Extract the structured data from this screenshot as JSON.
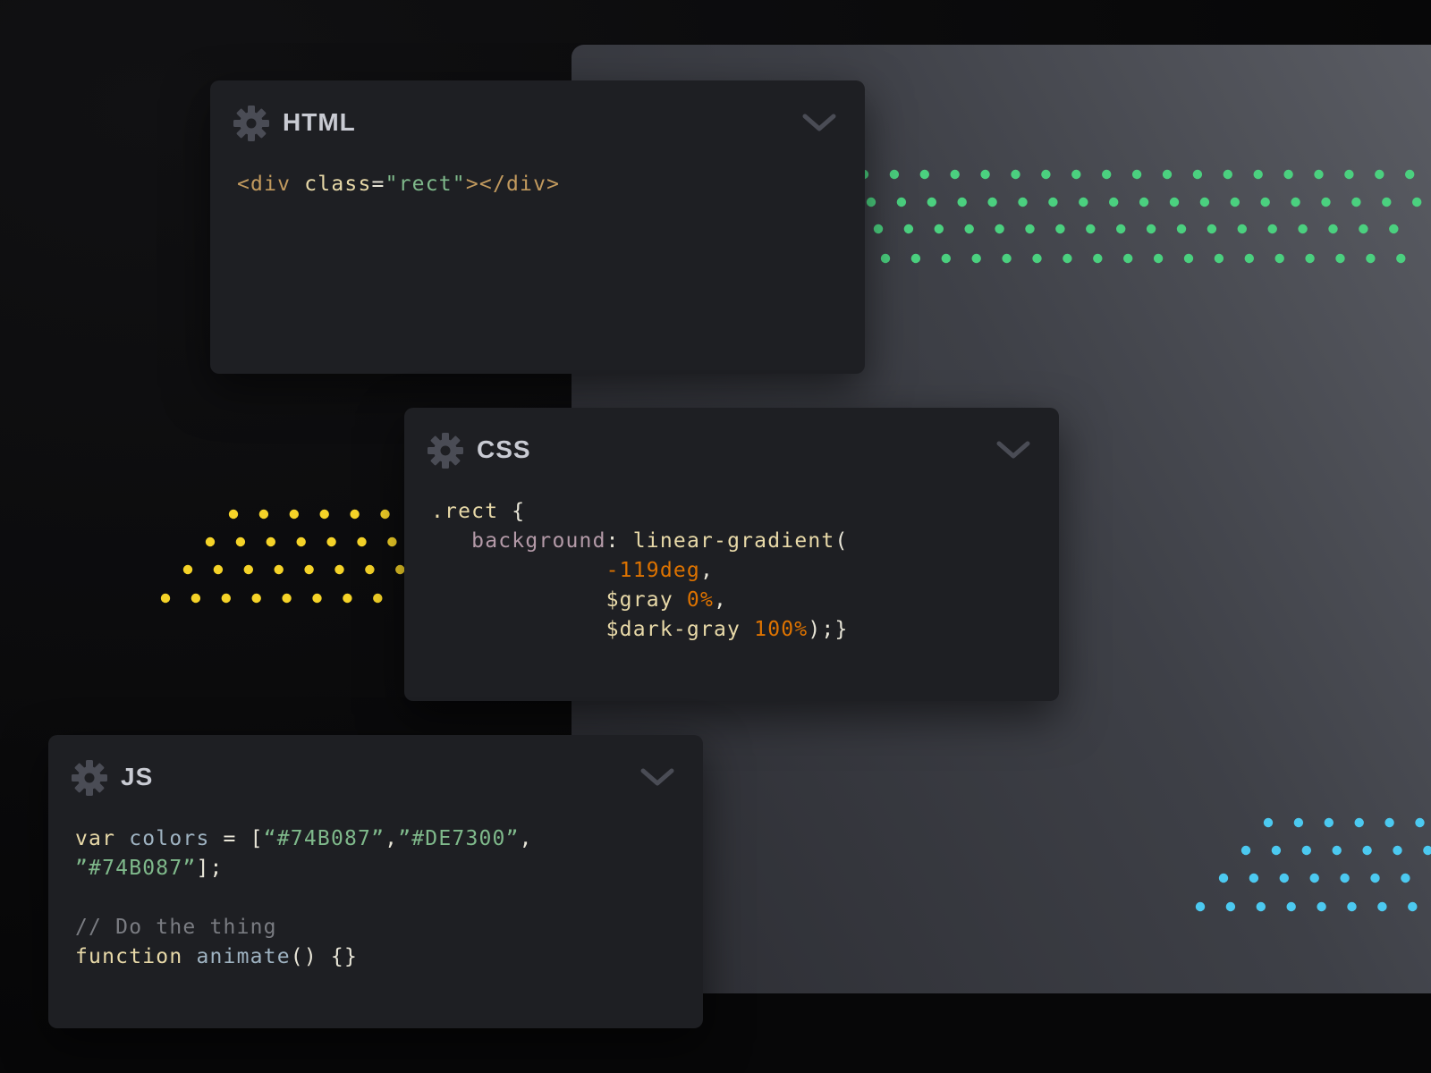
{
  "colors": {
    "background": "#070708",
    "preview_light": "#5a5c63",
    "preview_dark": "#2c2d33",
    "panel": "#1e1f23",
    "title": "#c9cbd3",
    "icon": "#4a4c55",
    "dots_green": "#4bd07f",
    "dots_yellow": "#f5d328",
    "dots_blue": "#4cc9f0"
  },
  "icons": {
    "settings": "gear-icon",
    "collapse": "chevron-down-icon"
  },
  "panels": {
    "html": {
      "title": "HTML",
      "code": {
        "l1_open": "<div ",
        "l1_attr": "class",
        "l1_eq": "=",
        "l1_val": "\"rect\"",
        "l1_close": "></div>"
      }
    },
    "css": {
      "title": "CSS",
      "code": {
        "l1_sel": ".rect ",
        "l1_brace": "{",
        "l2_indent": "   ",
        "l2_prop": "background",
        "l2_colon": ": ",
        "l2_func": "linear-gradient",
        "l2_paren": "(",
        "indent": "             ",
        "l3_num": "-119deg",
        "l3_comma": ",",
        "l4_var": "$gray ",
        "l4_num": "0%",
        "l4_comma": ",",
        "l5_var": "$dark-gray ",
        "l5_num": "100%",
        "l5_end": ");}"
      }
    },
    "js": {
      "title": "JS",
      "code": {
        "l1_kw": "var ",
        "l1_ident": "colors",
        "l1_eq": " = [",
        "l1_s1": "“#74B087”",
        "l1_c1": ",",
        "l1_s2": "”#DE7300”",
        "l1_c2": ",",
        "l2_s3": "”#74B087”",
        "l2_end": "];",
        "l4_comment": "// Do the thing",
        "l5_kw": "function ",
        "l5_ident": "animate",
        "l5_end": "() {}"
      }
    }
  }
}
